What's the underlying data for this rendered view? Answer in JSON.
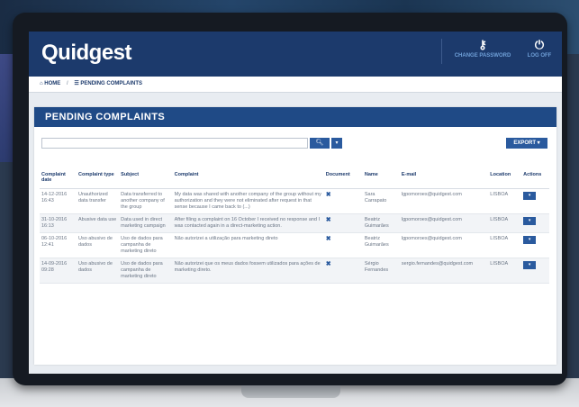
{
  "app": {
    "logo": "Quidgest",
    "change_password": "CHANGE PASSWORD",
    "log_off": "LOG OFF",
    "change_password_icon": "key-icon",
    "log_off_icon": "logout-icon"
  },
  "breadcrumb": {
    "home": "HOME",
    "current": "PENDING COMPLAINTS"
  },
  "panel": {
    "title": "PENDING COMPLAINTS",
    "search_placeholder": "",
    "search_icon": "search-icon",
    "export_label": "EXPORT"
  },
  "table": {
    "headers": [
      "Complaint date",
      "Complaint type",
      "Subject",
      "Complaint",
      "Document",
      "Name",
      "E-mail",
      "Location",
      "Actions"
    ],
    "rows": [
      {
        "date": "14-12-2016 16:43",
        "type": "Unauthorized data transfer",
        "subject": "Data transferred to another company of the group",
        "complaint": "My data was shared with another company of the group without my authorization and they were not eliminated after request in that sense because I came back to (...)",
        "name": "Sara Carrapato",
        "email": "lgpomoroes@quidgest.com",
        "location": "LISBOA"
      },
      {
        "date": "31-10-2016 16:13",
        "type": "Abusive data use",
        "subject": "Data used in direct marketing campaign",
        "complaint": "After filing a complaint on 16 October I received no response and I was contacted again in a direct-marketing action.",
        "name": "Beatriz Guimarães",
        "email": "lgpomoroes@quidgest.com",
        "location": "LISBOA"
      },
      {
        "date": "06-10-2016 12:41",
        "type": "Uso abusivo de dados",
        "subject": "Uso de dados para campanha de marketing direto",
        "complaint": "Não autorizei a utilização para marketing direto",
        "name": "Beatriz Guimarães",
        "email": "lgpomoroes@quidgest.com",
        "location": "LISBOA"
      },
      {
        "date": "14-09-2016 09:28",
        "type": "Uso abusivo de dados",
        "subject": "Uso de dados para campanha de marketing direto",
        "complaint": "Não autorizei que os meus dados fossem utilizados para ações de marketing direto.",
        "name": "Sérgio Fernandes",
        "email": "sergio.fernandes@quidgest.com",
        "location": "LISBOA"
      }
    ]
  }
}
